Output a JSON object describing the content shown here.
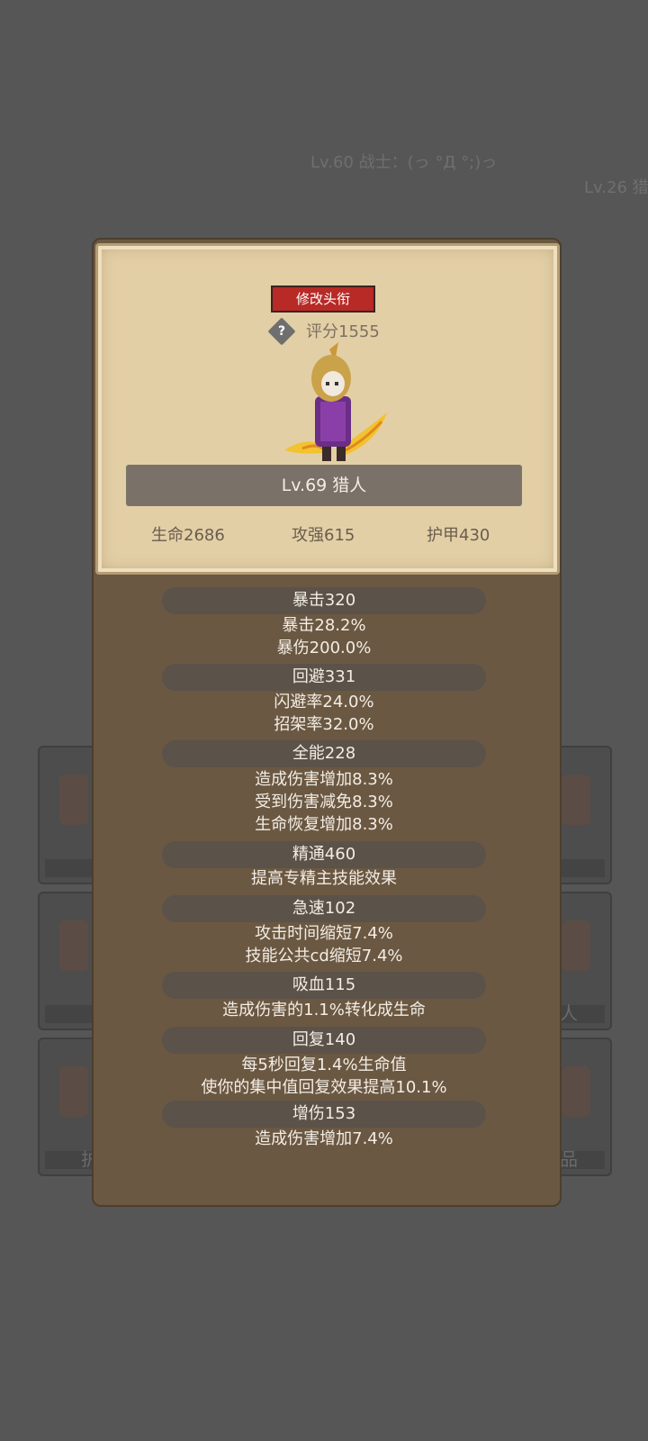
{
  "background": {
    "player_line_1": "Lv.60 战士：(っ °Д °;)っ",
    "player_line_2": "Lv.26 猎",
    "slot_labels": {
      "left_bottom": "护",
      "right_middle": "人",
      "right_bottom": "品"
    }
  },
  "card": {
    "edit_title_label": "修改头衔",
    "help_icon_glyph": "?",
    "score": "评分1555",
    "level_class": "Lv.69 猎人",
    "base_stats": [
      "生命2686",
      "攻强615",
      "护甲430"
    ]
  },
  "stats": {
    "crit": {
      "header": "暴击320",
      "lines": [
        "暴击28.2%",
        "暴伤200.0%"
      ]
    },
    "dodge": {
      "header": "回避331",
      "lines": [
        "闪避率24.0%",
        "招架率32.0%"
      ]
    },
    "versatility": {
      "header": "全能228",
      "lines": [
        "造成伤害增加8.3%",
        "受到伤害减免8.3%",
        "生命恢复增加8.3%"
      ]
    },
    "mastery": {
      "header": "精通460",
      "lines": [
        "提高专精主技能效果"
      ]
    },
    "haste": {
      "header": "急速102",
      "lines": [
        "攻击时间缩短7.4%",
        "技能公共cd缩短7.4%"
      ]
    },
    "lifesteal": {
      "header": "吸血115",
      "lines": [
        "造成伤害的1.1%转化成生命"
      ]
    },
    "regen": {
      "header": "回复140",
      "lines": [
        "每5秒回复1.4%生命值",
        "使你的集中值回复效果提高10.1%"
      ]
    },
    "damage_boost": {
      "header": "增伤153",
      "lines": [
        "造成伤害增加7.4%"
      ]
    }
  },
  "colors": {
    "title_button": "#b82a26",
    "panel": "#6b5842",
    "card": "#e3cfa6",
    "stat_header_bg": "#5b5249",
    "text_light": "#f2ede5"
  }
}
